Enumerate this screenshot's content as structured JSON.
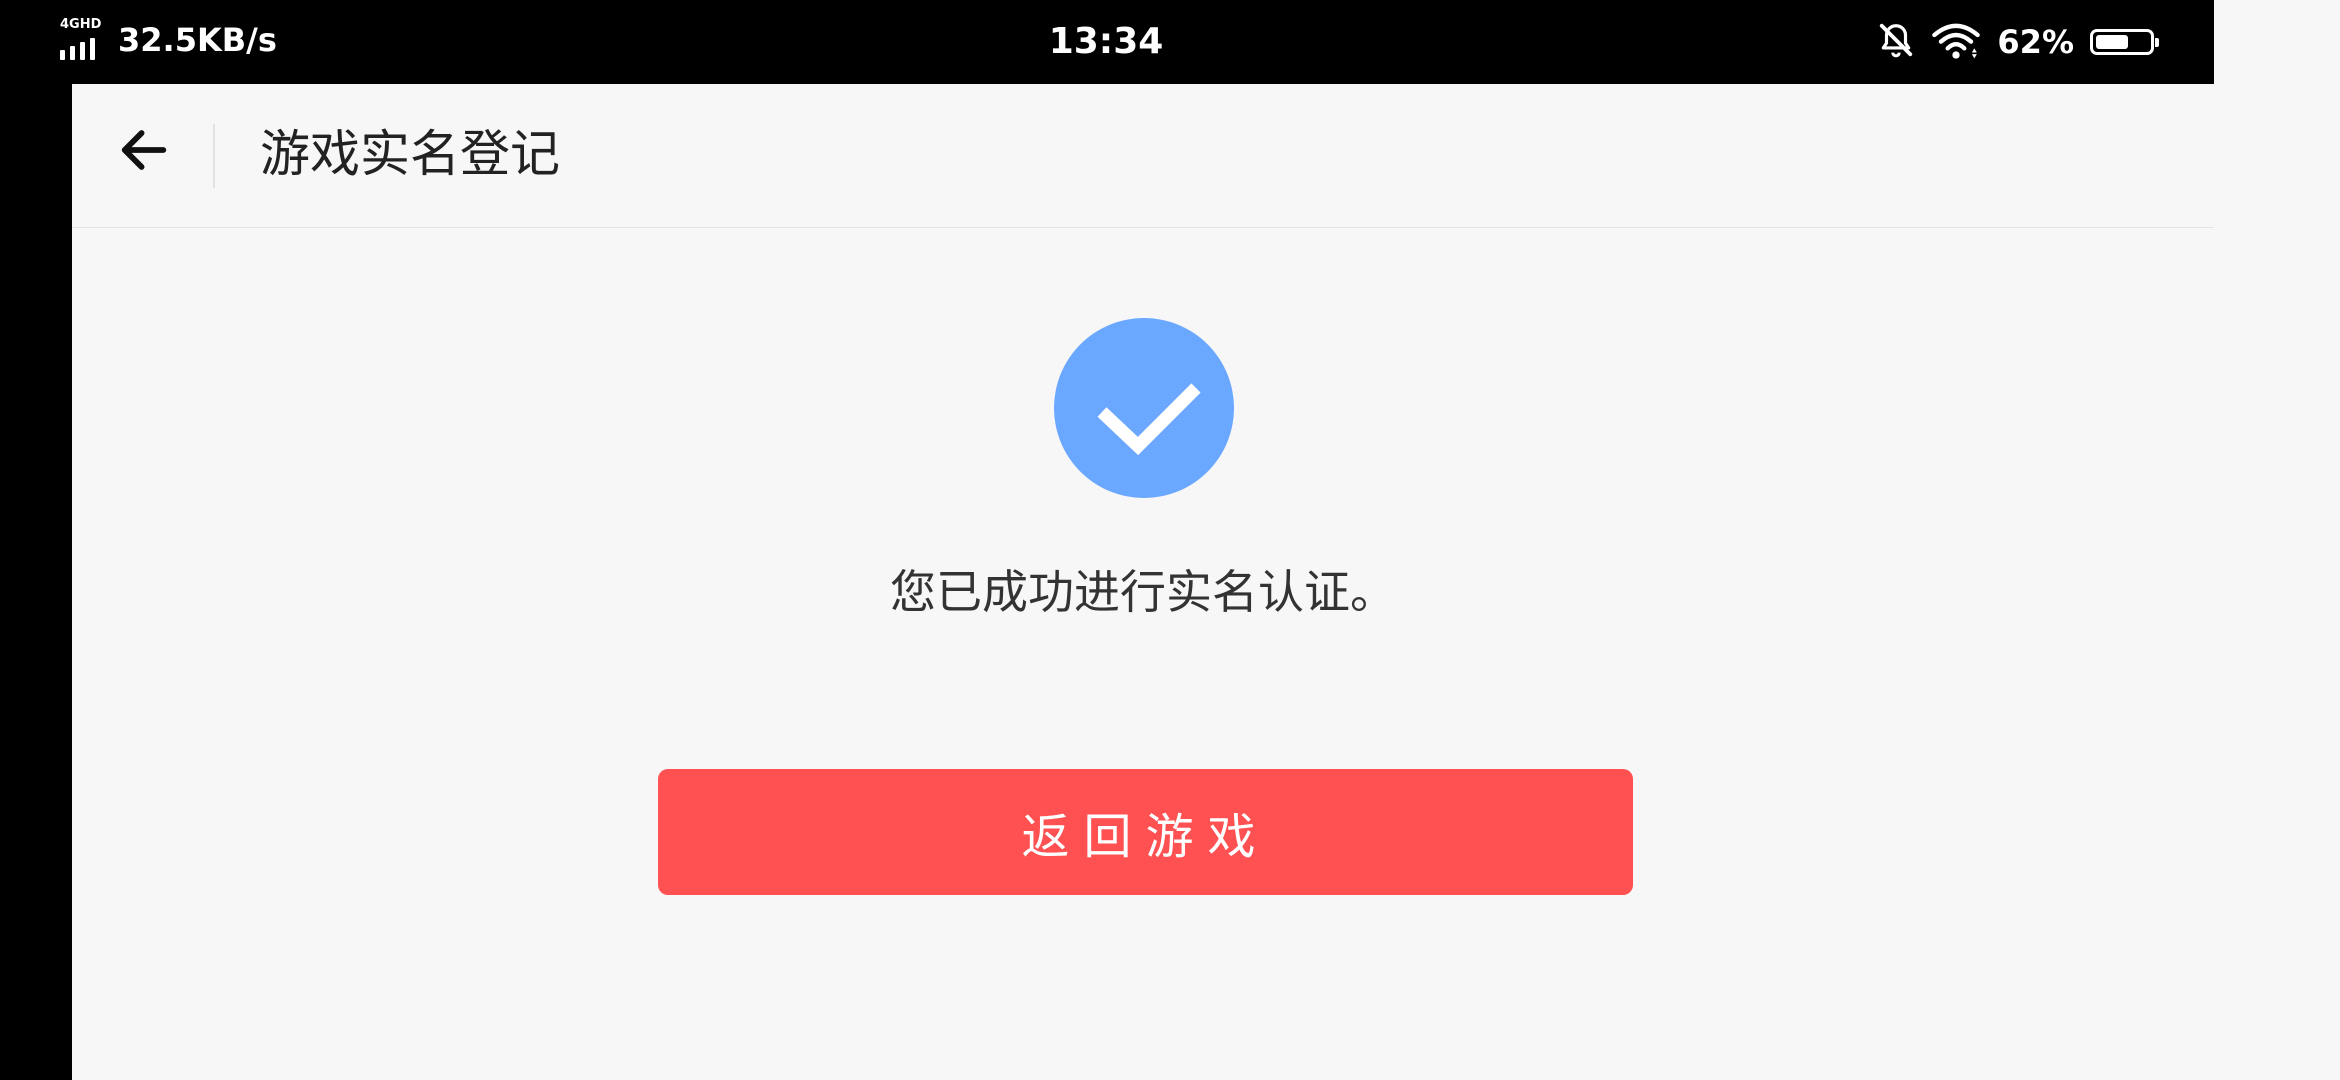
{
  "status_bar": {
    "network_type": "4GHD",
    "net_speed": "32.5KB/s",
    "time": "13:34",
    "battery_percent": "62%",
    "battery_level": 0.62,
    "icons": [
      "signal-icon",
      "bell-muted-icon",
      "wifi-icon",
      "battery-icon"
    ]
  },
  "header": {
    "back_icon": "arrow-left-icon",
    "title": "游戏实名登记"
  },
  "main": {
    "success_icon": "check-circle-icon",
    "message": "您已成功进行实名认证。",
    "return_button_label": "返回游戏"
  },
  "colors": {
    "accent_blue": "#6aa7ff",
    "button_red": "#ff5052",
    "background": "#f7f7f7"
  }
}
